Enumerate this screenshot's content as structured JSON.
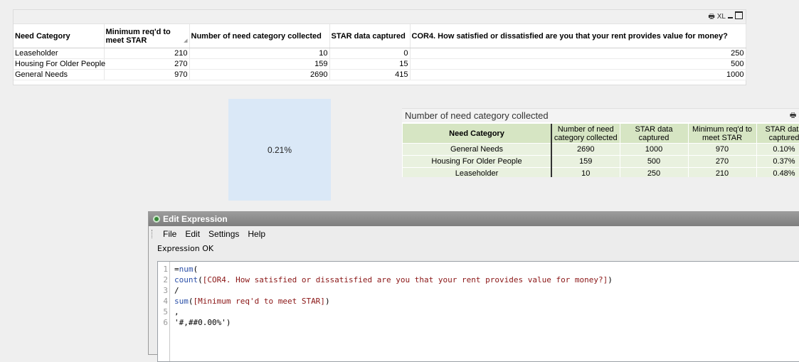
{
  "top_table": {
    "caption_icons": [
      "print-icon",
      "xl-icon",
      "minimize-icon",
      "maximize-icon"
    ],
    "xl_label": "XL",
    "headers": [
      "Need Category",
      "Minimum req'd to meet STAR",
      "Number of need category collected",
      "STAR data captured",
      "COR4. How satisfied or dissatisfied are you that your rent provides value for money?"
    ],
    "rows": [
      [
        "Leaseholder",
        "210",
        "10",
        "0",
        "250"
      ],
      [
        "Housing For Older People",
        "270",
        "159",
        "15",
        "500"
      ],
      [
        "General Needs",
        "970",
        "2690",
        "415",
        "1000"
      ]
    ]
  },
  "kpi": {
    "value": "0.21%"
  },
  "chart2": {
    "title": "Number of need category collected",
    "headers": [
      "Need Category",
      "Number of need category collected",
      "STAR data captured",
      "Minimum req'd to meet STAR",
      "STAR data captured"
    ],
    "rows": [
      [
        "General Needs",
        "2690",
        "1000",
        "970",
        "0.10%"
      ],
      [
        "Housing For Older People",
        "159",
        "500",
        "270",
        "0.37%"
      ],
      [
        "Leaseholder",
        "10",
        "250",
        "210",
        "0.48%"
      ]
    ]
  },
  "dialog": {
    "title": "Edit Expression",
    "menu": [
      "File",
      "Edit",
      "Settings",
      "Help"
    ],
    "status": "Expression OK",
    "lines": [
      {
        "n": "1",
        "parts": [
          {
            "t": "=",
            "c": "str"
          },
          {
            "t": "num",
            "c": "fn"
          },
          {
            "t": "(",
            "c": "str"
          }
        ]
      },
      {
        "n": "2",
        "parts": [
          {
            "t": "count",
            "c": "fn"
          },
          {
            "t": "(",
            "c": "str"
          },
          {
            "t": "[COR4. How satisfied or dissatisfied are you that your rent provides value for money?]",
            "c": "fld"
          },
          {
            "t": ")",
            "c": "str"
          }
        ]
      },
      {
        "n": "3",
        "parts": [
          {
            "t": "/",
            "c": "str"
          }
        ]
      },
      {
        "n": "4",
        "parts": [
          {
            "t": "sum",
            "c": "fn"
          },
          {
            "t": "(",
            "c": "str"
          },
          {
            "t": "[Minimum req'd to meet STAR]",
            "c": "fld"
          },
          {
            "t": ")",
            "c": "str"
          }
        ]
      },
      {
        "n": "5",
        "parts": [
          {
            "t": ",",
            "c": "str"
          }
        ]
      },
      {
        "n": "6",
        "parts": [
          {
            "t": "'#,##0.00%'",
            "c": "str"
          },
          {
            "t": ")",
            "c": "str"
          }
        ]
      }
    ]
  }
}
